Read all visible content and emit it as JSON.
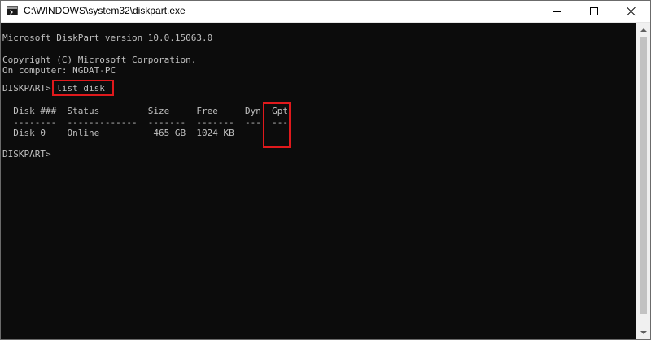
{
  "window": {
    "title": "C:\\WINDOWS\\system32\\diskpart.exe"
  },
  "console": {
    "lines": [
      "Microsoft DiskPart version 10.0.15063.0",
      "Copyright (C) Microsoft Corporation.",
      "On computer: NGDAT-PC",
      "DISKPART> list disk",
      "  Disk ###  Status         Size     Free     Dyn  Gpt",
      "  --------  -------------  -------  -------  ---  ---",
      "  Disk 0    Online          465 GB  1024 KB",
      "DISKPART> "
    ]
  },
  "highlight_color": "#e0191c",
  "icons": {
    "app": "console-app-icon",
    "minimize": "minimize-icon",
    "maximize": "maximize-icon",
    "close": "close-icon"
  }
}
